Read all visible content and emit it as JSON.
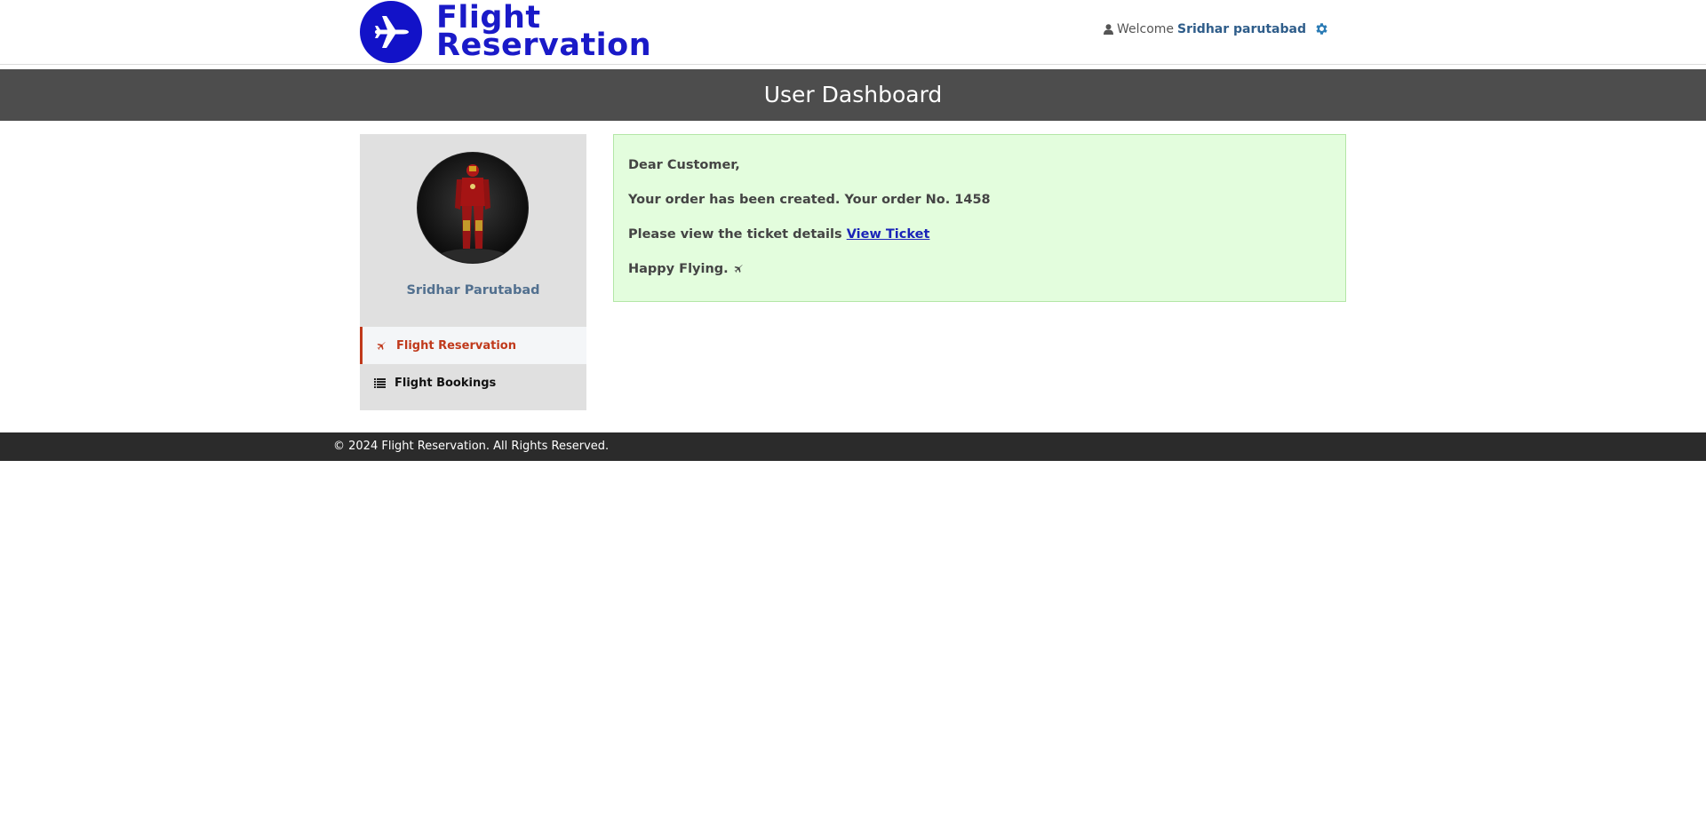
{
  "header": {
    "logo_line1": "Flight",
    "logo_line2": "Reservation",
    "welcome_label": "Welcome",
    "username": "Sridhar parutabad"
  },
  "page_title": "User Dashboard",
  "sidebar": {
    "profile_name": "Sridhar Parutabad",
    "items": [
      {
        "label": "Flight Reservation",
        "icon": "plane-icon",
        "active": true
      },
      {
        "label": "Flight Bookings",
        "icon": "list-icon",
        "active": false
      }
    ]
  },
  "message": {
    "greeting": "Dear Customer,",
    "order_text": "Your order has been created. Your order No. 1458",
    "ticket_text": "Please view the ticket details",
    "ticket_link": "View Ticket",
    "closing": "Happy Flying."
  },
  "footer": {
    "copyright": "© 2024 Flight Reservation. All Rights Reserved."
  },
  "colors": {
    "logo_blue": "#1212c8",
    "title_bar": "#4d4d4d",
    "active_nav": "#c0391b",
    "success_bg": "#e3fddd",
    "footer_bg": "#2b2b2b"
  }
}
